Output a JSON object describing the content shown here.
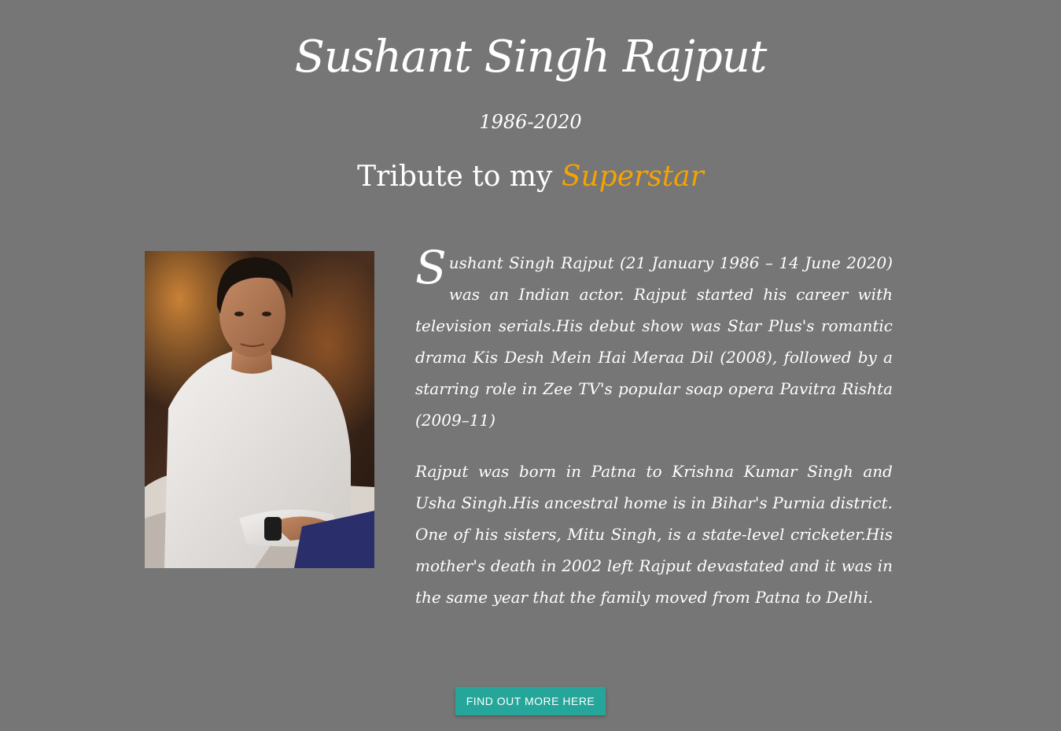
{
  "header": {
    "title": "Sushant Singh Rajput",
    "years": "1986-2020",
    "tribute_prefix": "Tribute to my",
    "tribute_highlight": "Superstar"
  },
  "bio": {
    "p1_initial": "S",
    "p1_rest": "ushant Singh Rajput (21 January 1986 – 14 June 2020) was an Indian actor. Rajput started his career with television serials.His debut show was Star Plus's romantic drama Kis Desh Mein Hai Meraa Dil (2008), followed by a starring role in Zee TV's popular soap opera Pavitra Rishta (2009–11)",
    "p2": "Rajput was born in Patna to Krishna Kumar Singh and Usha Singh.His ancestral home is in Bihar's Purnia district. One of his sisters, Mitu Singh, is a state-level cricketer.His mother's death in 2002 left Rajput devastated and it was in the same year that the family moved from Patna to Delhi."
  },
  "cta": {
    "label": "FIND OUT MORE HERE"
  },
  "colors": {
    "background": "#767676",
    "accent": "#f4a300",
    "button": "#26a69a"
  }
}
